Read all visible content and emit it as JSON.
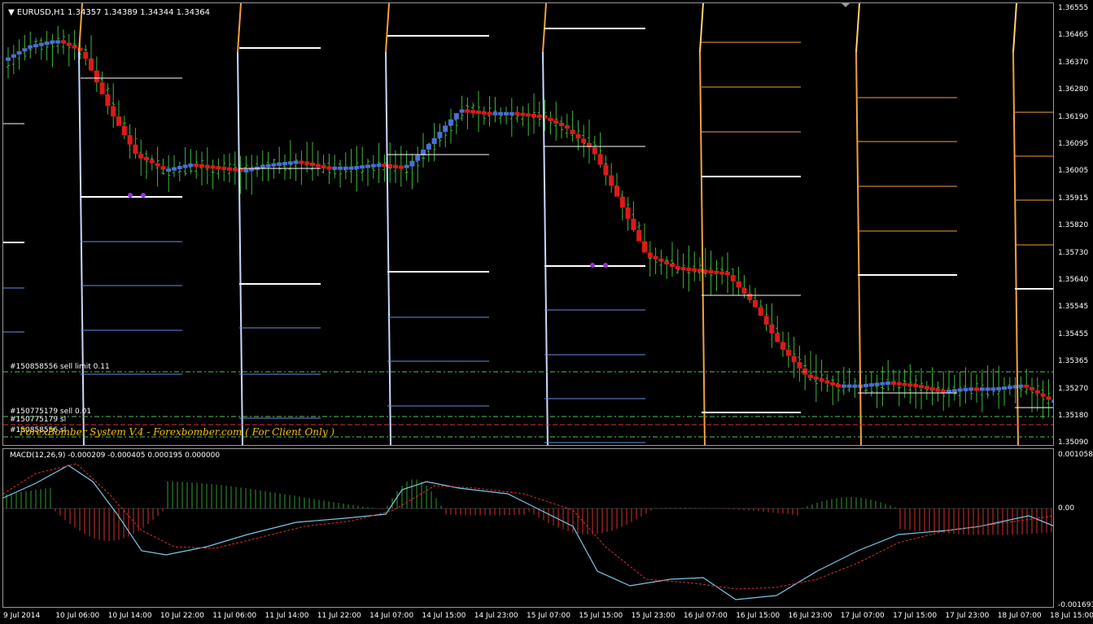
{
  "window": {
    "symbol_title": "EURUSD,H1  1.34357 1.34389 1.34344 1.34364"
  },
  "orders": [
    {
      "label": "#150858556 sell limit 0.11"
    },
    {
      "label": "#150775179 sell 0.01"
    },
    {
      "label": "#150775179 sl"
    },
    {
      "label": "#150858556 sl"
    }
  ],
  "watermark": "ForexBomber System V.4 - Forexbomber.com ( For Client Only )",
  "price_axis": [
    "1.36555",
    "1.36465",
    "1.36370",
    "1.36280",
    "1.36190",
    "1.36095",
    "1.36005",
    "1.35915",
    "1.35820",
    "1.35730",
    "1.35640",
    "1.35545",
    "1.35455",
    "1.35365",
    "1.35270",
    "1.35180",
    "1.35090"
  ],
  "macd": {
    "title": "MACD(12,26,9) -0.000209 -0.000405 0.000195 0.000000",
    "axis": [
      "0.001058",
      "0.00",
      "-0.001693"
    ]
  },
  "time_axis": [
    "9 Jul 2014",
    "10 Jul 06:00",
    "10 Jul 14:00",
    "10 Jul 22:00",
    "11 Jul 06:00",
    "11 Jul 14:00",
    "11 Jul 22:00",
    "14 Jul 07:00",
    "14 Jul 15:00",
    "14 Jul 23:00",
    "15 Jul 07:00",
    "15 Jul 15:00",
    "15 Jul 23:00",
    "16 Jul 07:00",
    "16 Jul 15:00",
    "16 Jul 23:00",
    "17 Jul 07:00",
    "17 Jul 15:00",
    "17 Jul 23:00",
    "18 Jul 07:00",
    "18 Jul 15:00"
  ],
  "colors": {
    "bull": "#4a6fd6",
    "bear": "#e01818",
    "wick": "#3cb83c",
    "level_white": "#ffffff",
    "level_blue": "#6b8ce6",
    "level_orange": "#f2a040",
    "order_green": "#55c855",
    "order_red": "#e03030",
    "macd_line": "#7ec8e8",
    "macd_signal": "#d83030"
  },
  "chart_data": {
    "type": "line",
    "series": [
      {
        "name": "EURUSD,H1",
        "values": [
          1.3636,
          1.3641,
          1.3643,
          1.3639,
          1.362,
          1.3605,
          1.36,
          1.3602,
          1.3601,
          1.36,
          1.3602,
          1.3603,
          1.3601,
          1.3601,
          1.3602,
          1.3601,
          1.361,
          1.362,
          1.3619,
          1.3619,
          1.3618,
          1.3614,
          1.3607,
          1.359,
          1.3572,
          1.3568,
          1.3567,
          1.3566,
          1.3556,
          1.3542,
          1.3532,
          1.3529,
          1.3529,
          1.353,
          1.3529,
          1.3527,
          1.3528,
          1.3528,
          1.3529,
          1.3524
        ]
      }
    ],
    "ylim": [
      1.3509,
      1.36555
    ]
  }
}
